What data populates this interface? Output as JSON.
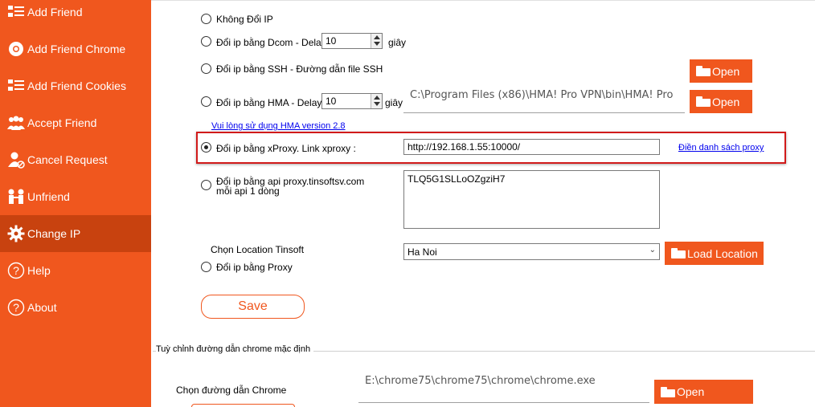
{
  "sidebar": {
    "items": [
      {
        "label": "Add Friend",
        "icon": "list-icon"
      },
      {
        "label": "Add Friend Chrome",
        "icon": "chrome-icon"
      },
      {
        "label": "Add Friend Cookies",
        "icon": "list-icon"
      },
      {
        "label": "Accept Friend",
        "icon": "users-icon"
      },
      {
        "label": "Cancel Request",
        "icon": "user-cancel-icon"
      },
      {
        "label": "Unfriend",
        "icon": "unfriend-icon"
      },
      {
        "label": "Change IP",
        "icon": "gear-icon",
        "active": true
      },
      {
        "label": "Help",
        "icon": "help-icon"
      },
      {
        "label": "About",
        "icon": "help-icon"
      }
    ]
  },
  "ip_section": {
    "options": {
      "no_change": "Không Đổi IP",
      "dcom": "Đổi ip bằng Dcom - Delay",
      "ssh": "Đổi ip bằng SSH - Đường dẫn file SSH",
      "hma": "Đổi ip bằng HMA - Delay",
      "xproxy": "Đổi ip bằng xProxy. Link xproxy :",
      "tinsoft_line1": "Đổi ip bằng api proxy.tinsoftsv.com",
      "tinsoft_line2": "mỗi api 1 dòng",
      "proxy": "Đổi ip bằng Proxy"
    },
    "selected": "xproxy",
    "dcom_delay": "10",
    "hma_delay": "10",
    "seconds_label": "giây",
    "hma_path": "C:\\Program Files (x86)\\HMA! Pro VPN\\bin\\HMA! Pro",
    "hma_note": "Vui lòng sử dụng HMA version 2.8",
    "xproxy_link": "http://192.168.1.55:10000/",
    "proxy_list_link": "Điền danh sách proxy",
    "tinsoft_keys": "TLQ5G1SLLoOZgziH7",
    "location_label": "Chọn Location Tinsoft",
    "location_value": "Ha Noi",
    "open_label": "Open",
    "load_location_label": "Load Location",
    "save_label": "Save"
  },
  "chrome_section": {
    "title": "Tuỳ chỉnh đường dẫn chrome mặc định",
    "path_label": "Chọn đường dẫn Chrome",
    "path_value": "E:\\chrome75\\chrome75\\chrome\\chrome.exe",
    "open_label": "Open"
  },
  "colors": {
    "sidebar": "#f0571e",
    "sidebar_active": "#c8420f",
    "highlight_border": "#d11a1a",
    "link": "#0000ee"
  }
}
